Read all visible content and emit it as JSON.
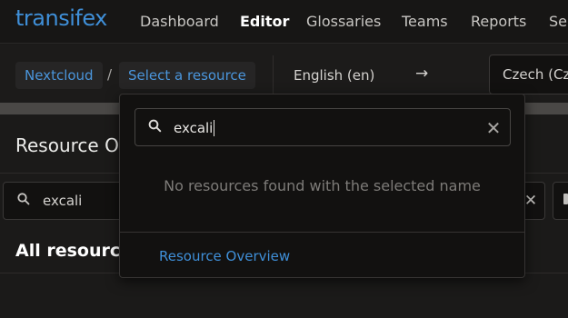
{
  "app": {
    "brand": "transifex"
  },
  "nav": {
    "items": [
      {
        "label": "Dashboard",
        "active": false
      },
      {
        "label": "Editor",
        "active": true
      },
      {
        "label": "Glossaries",
        "active": false
      },
      {
        "label": "Teams",
        "active": false
      },
      {
        "label": "Reports",
        "active": false
      },
      {
        "label": "Se",
        "active": false
      }
    ]
  },
  "breadcrumb": {
    "project": "Nextcloud",
    "separator": "/",
    "resource": "Select a resource"
  },
  "languages": {
    "source": "English (en)",
    "arrow": "→",
    "target": "Czech (Cz"
  },
  "background": {
    "page_title": "Resource Ov",
    "search_icon": "search-icon",
    "search_value": "excali",
    "clear_glyph": "✕",
    "section_title": "All resource"
  },
  "dropdown": {
    "search_icon": "search-icon",
    "search_value": "excali",
    "clear_glyph": "✕",
    "empty_message": "No resources found with the selected name",
    "overview_link": "Resource Overview"
  },
  "colors": {
    "accent": "#3f8fd8",
    "background": "#1b1a19",
    "panel": "#121110"
  }
}
